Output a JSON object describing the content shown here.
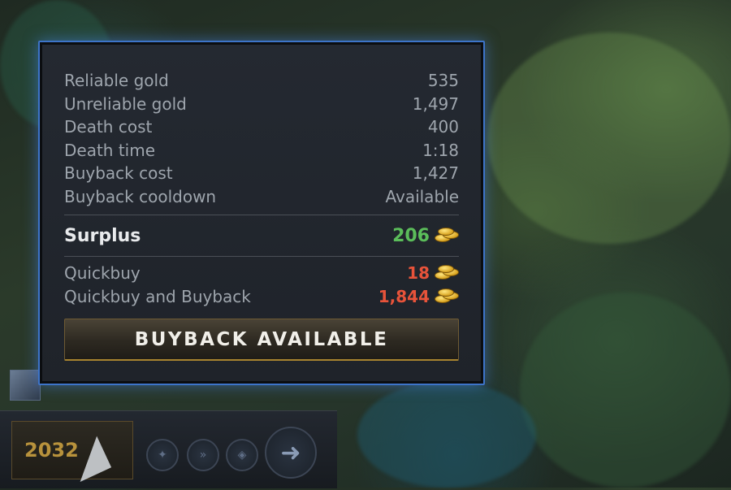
{
  "tooltip": {
    "rows": [
      {
        "label": "Reliable gold",
        "value": "535"
      },
      {
        "label": "Unreliable gold",
        "value": "1,497"
      },
      {
        "label": "Death cost",
        "value": "400"
      },
      {
        "label": "Death time",
        "value": "1:18"
      },
      {
        "label": "Buyback cost",
        "value": "1,427"
      },
      {
        "label": "Buyback cooldown",
        "value": "Available"
      }
    ],
    "surplus": {
      "label": "Surplus",
      "value": "206",
      "icon": "gold-coins-icon",
      "color": "#5bbd5a"
    },
    "quickbuy": {
      "label": "Quickbuy",
      "value": "18",
      "icon": "gold-coins-icon",
      "color": "#e8533a"
    },
    "quickbuy_buyback": {
      "label": "Quickbuy and Buyback",
      "value": "1,844",
      "icon": "gold-coins-icon",
      "color": "#e8533a"
    },
    "buyback_button": "BUYBACK AVAILABLE"
  },
  "hud": {
    "gold": "2032",
    "buttons": [
      "courier-icon",
      "speed-burst-icon",
      "shield-icon",
      "deliver-arrow-icon"
    ]
  },
  "colors": {
    "panel_border": "#3d74c9",
    "accent_gold": "#a8842f"
  }
}
